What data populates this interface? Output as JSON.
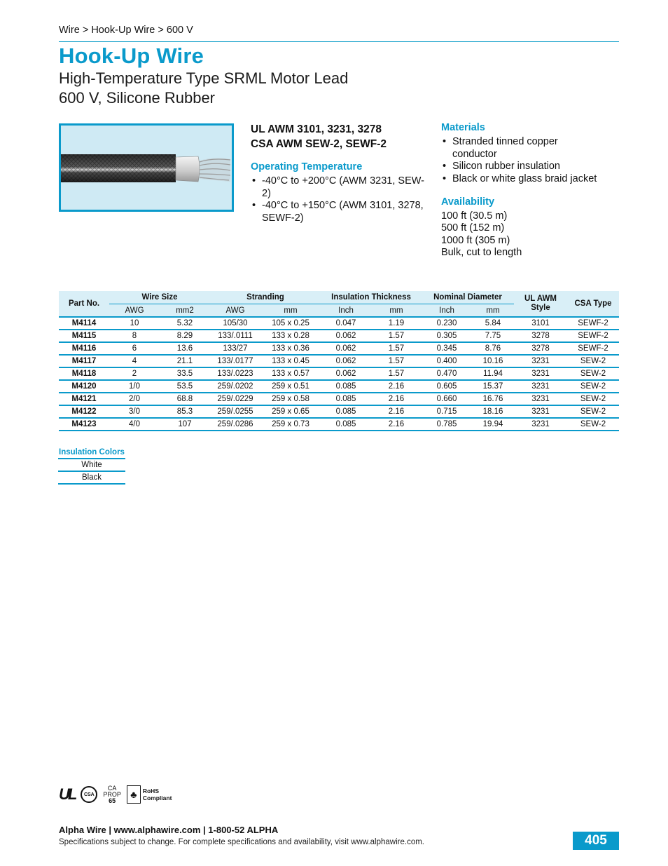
{
  "breadcrumb": "Wire > Hook-Up Wire > 600 V",
  "title": "Hook-Up Wire",
  "subtitle_line1": "High-Temperature Type SRML Motor Lead",
  "subtitle_line2": "600 V, Silicone Rubber",
  "approvals": {
    "line1": "UL AWM 3101, 3231, 3278",
    "line2": "CSA AWM SEW-2, SEWF-2"
  },
  "operating_temperature": {
    "heading": "Operating Temperature",
    "items": [
      "-40°C to +200°C (AWM 3231, SEW-2)",
      "-40°C to +150°C (AWM 3101, 3278, SEWF-2)"
    ]
  },
  "materials": {
    "heading": "Materials",
    "items": [
      "Stranded tinned copper conductor",
      "Silicon rubber insulation",
      "Black or white glass braid jacket"
    ]
  },
  "availability": {
    "heading": "Availability",
    "items": [
      "100 ft (30.5 m)",
      "500 ft (152 m)",
      "1000 ft (305 m)",
      "Bulk, cut to length"
    ]
  },
  "table": {
    "headers": {
      "part_no": "Part No.",
      "wire_size": "Wire Size",
      "stranding": "Stranding",
      "insulation_thickness": "Insulation Thickness",
      "nominal_diameter": "Nominal Diameter",
      "ul_awm_style": "UL AWM Style",
      "csa_type": "CSA Type",
      "sub": [
        "AWG",
        "mm2",
        "AWG",
        "mm",
        "Inch",
        "mm",
        "Inch",
        "mm"
      ]
    },
    "rows": [
      [
        "M4114",
        "10",
        "5.32",
        "105/30",
        "105 x 0.25",
        "0.047",
        "1.19",
        "0.230",
        "5.84",
        "3101",
        "SEWF-2"
      ],
      [
        "M4115",
        "8",
        "8.29",
        "133/.0111",
        "133 x 0.28",
        "0.062",
        "1.57",
        "0.305",
        "7.75",
        "3278",
        "SEWF-2"
      ],
      [
        "M4116",
        "6",
        "13.6",
        "133/27",
        "133 x 0.36",
        "0.062",
        "1.57",
        "0.345",
        "8.76",
        "3278",
        "SEWF-2"
      ],
      [
        "M4117",
        "4",
        "21.1",
        "133/.0177",
        "133 x 0.45",
        "0.062",
        "1.57",
        "0.400",
        "10.16",
        "3231",
        "SEW-2"
      ],
      [
        "M4118",
        "2",
        "33.5",
        "133/.0223",
        "133 x 0.57",
        "0.062",
        "1.57",
        "0.470",
        "11.94",
        "3231",
        "SEW-2"
      ],
      [
        "M4120",
        "1/0",
        "53.5",
        "259/.0202",
        "259 x 0.51",
        "0.085",
        "2.16",
        "0.605",
        "15.37",
        "3231",
        "SEW-2"
      ],
      [
        "M4121",
        "2/0",
        "68.8",
        "259/.0229",
        "259 x 0.58",
        "0.085",
        "2.16",
        "0.660",
        "16.76",
        "3231",
        "SEW-2"
      ],
      [
        "M4122",
        "3/0",
        "85.3",
        "259/.0255",
        "259 x  0.65",
        "0.085",
        "2.16",
        "0.715",
        "18.16",
        "3231",
        "SEW-2"
      ],
      [
        "M4123",
        "4/0",
        "107",
        "259/.0286",
        "259 x 0.73",
        "0.085",
        "2.16",
        "0.785",
        "19.94",
        "3231",
        "SEW-2"
      ]
    ]
  },
  "insulation_colors": {
    "heading": "Insulation Colors",
    "items": [
      "White",
      "Black"
    ]
  },
  "logos": {
    "ul": "UL",
    "csa": "CSA",
    "prop65": [
      "CA",
      "PROP",
      "65"
    ],
    "rohs": [
      "RoHS",
      "Compliant"
    ]
  },
  "footer": {
    "main": "Alpha Wire | www.alphawire.com | 1-800-52 ALPHA",
    "note": "Specifications subject to change. For complete specifications and availability, visit www.alphawire.com.",
    "page_number": "405"
  },
  "colors": {
    "accent": "#0a9acb",
    "header_bg": "#d9eff7",
    "image_bg": "#cfeaf4"
  }
}
